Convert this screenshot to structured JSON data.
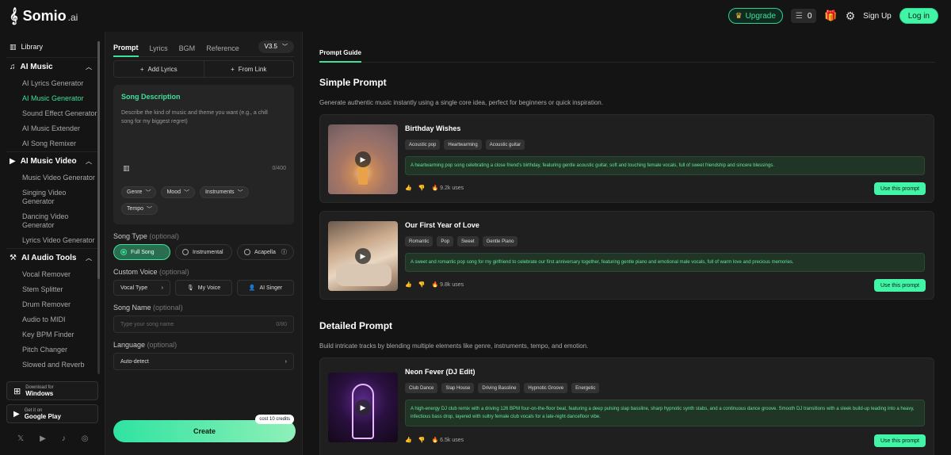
{
  "header": {
    "logo_text": "Somio",
    "logo_suffix": ".ai",
    "upgrade_label": "Upgrade",
    "credits": "0",
    "signup_label": "Sign Up",
    "login_label": "Log in"
  },
  "sidebar": {
    "library": "Library",
    "groups": [
      {
        "title": "AI Music",
        "items": [
          "AI Lyrics Generator",
          "AI Music Generator",
          "Sound Effect Generator",
          "AI Music Extender",
          "AI Song Remixer"
        ]
      },
      {
        "title": "AI Music Video",
        "items": [
          "Music Video Generator",
          "Singing Video Generator",
          "Dancing Video Generator",
          "Lyrics Video Generator"
        ]
      },
      {
        "title": "AI Audio Tools",
        "items": [
          "Vocal Remover",
          "Stem Splitter",
          "Drum Remover",
          "Audio to MIDI",
          "Key BPM Finder",
          "Pitch Changer",
          "Slowed and Reverb"
        ]
      }
    ],
    "active_item": "AI Music Generator",
    "windows": {
      "small": "Download for",
      "big": "Windows"
    },
    "gplay": {
      "small": "Get it on",
      "big": "Google Play"
    }
  },
  "form": {
    "tabs": [
      "Prompt",
      "Lyrics",
      "BGM",
      "Reference"
    ],
    "version": "V3.5",
    "add_lyrics": "Add Lyrics",
    "from_link": "From Link",
    "desc_title": "Song Description",
    "desc_placeholder": "Describe the kind of music and theme you want (e.g., a chill song for my biggest regret)",
    "desc_count": "0/400",
    "chips": [
      "Genre",
      "Mood",
      "Instruments",
      "Tempo"
    ],
    "song_type_label": "Song Type",
    "optional": "(optional)",
    "song_types": [
      "Full Song",
      "Instrumental",
      "Acapella"
    ],
    "custom_voice_label": "Custom Voice",
    "voice_options": [
      "Vocal Type",
      "My Voice",
      "AI Singer"
    ],
    "song_name_label": "Song Name",
    "song_name_placeholder": "Type your song name",
    "song_name_count": "0/80",
    "language_label": "Language",
    "language_value": "Auto-detect",
    "create_label": "Create",
    "cost_label": "cost 10 credits"
  },
  "guide": {
    "tab": "Prompt Guide",
    "simple_title": "Simple Prompt",
    "simple_desc": "Generate authentic music instantly using a single core idea, perfect for beginners or quick inspiration.",
    "detailed_title": "Detailed Prompt",
    "detailed_desc": "Build intricate tracks by blending multiple elements like genre, instruments, tempo, and emotion.",
    "use_label": "Use this prompt",
    "cards": [
      {
        "title": "Birthday Wishes",
        "tags": [
          "Acoustic pop",
          "Heartwarming",
          "Acoustic guitar"
        ],
        "prompt": "A heartwarming pop song celebrating a close friend's birthday, featuring gentle acoustic guitar, soft and touching female vocals, full of sweet friendship and sincere blessings.",
        "uses": "9.2k uses"
      },
      {
        "title": "Our First Year of Love",
        "tags": [
          "Romantic",
          "Pop",
          "Sweet",
          "Gentle Piano"
        ],
        "prompt": "A sweet and romantic pop song for my girlfriend to celebrate our first anniversary together, featuring gentle piano and emotional male vocals, full of warm love and precious memories.",
        "uses": "9.8k uses"
      },
      {
        "title": "Neon Fever (DJ Edit)",
        "tags": [
          "Club Dance",
          "Slap House",
          "Driving Bassline",
          "Hypnotic Groove",
          "Energetic"
        ],
        "prompt": "A high-energy DJ club remix with a driving 126 BPM four-on-the-floor beat, featuring a deep pulsing slap bassline, sharp hypnotic synth stabs, and a continuous dance groove. Smooth DJ transitions with a sleek build-up leading into a heavy, infectious bass drop, layered with sultry female club vocals for a late-night dancefloor vibe.",
        "uses": "6.5k uses"
      }
    ]
  },
  "colors": {
    "accent": "#3fe09a",
    "background": "#141414",
    "panel": "#1b1b1b"
  }
}
